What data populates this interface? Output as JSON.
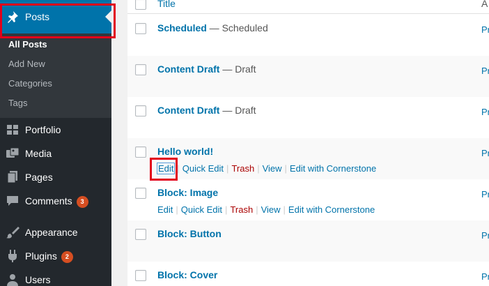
{
  "sidebar": {
    "current_menu": {
      "label": "Posts",
      "icon": "pushpin-icon"
    },
    "submenu": [
      {
        "label": "All Posts",
        "current": true
      },
      {
        "label": "Add New",
        "current": false
      },
      {
        "label": "Categories",
        "current": false
      },
      {
        "label": "Tags",
        "current": false
      }
    ],
    "items": [
      {
        "label": "Portfolio",
        "icon": "portfolio-icon",
        "badge": ""
      },
      {
        "label": "Media",
        "icon": "media-icon",
        "badge": ""
      },
      {
        "label": "Pages",
        "icon": "pages-icon",
        "badge": ""
      },
      {
        "label": "Comments",
        "icon": "comment-bubble-icon",
        "badge": "3"
      },
      {
        "label": "Appearance",
        "icon": "paintbrush-icon",
        "badge": ""
      },
      {
        "label": "Plugins",
        "icon": "plugin-icon",
        "badge": "2"
      },
      {
        "label": "Users",
        "icon": "users-icon",
        "badge": ""
      }
    ]
  },
  "table": {
    "header": {
      "title": "Title",
      "author": "A"
    },
    "rows": [
      {
        "title": "Scheduled",
        "state": " — Scheduled",
        "author": "Pr"
      },
      {
        "title": "Content Draft",
        "state": " — Draft",
        "author": "Pr"
      },
      {
        "title": "Content Draft",
        "state": " — Draft",
        "author": "Pr"
      },
      {
        "title": "Hello world!",
        "state": "",
        "author": "Pr"
      },
      {
        "title": "Block: Image",
        "state": "",
        "author": "Pr"
      },
      {
        "title": "Block: Button",
        "state": "",
        "author": "Pr"
      },
      {
        "title": "Block: Cover",
        "state": "",
        "author": "Pr"
      }
    ],
    "row_actions": {
      "edit": "Edit",
      "quick_edit": "Quick Edit",
      "trash": "Trash",
      "view": "View",
      "cornerstone": "Edit with Cornerstone",
      "separator": "|"
    }
  },
  "colors": {
    "sidebar_bg": "#23282d",
    "submenu_bg": "#32373c",
    "accent": "#0073aa",
    "link": "#0073aa",
    "trash": "#a00",
    "badge": "#d54e21",
    "highlight": "#e2001a"
  }
}
